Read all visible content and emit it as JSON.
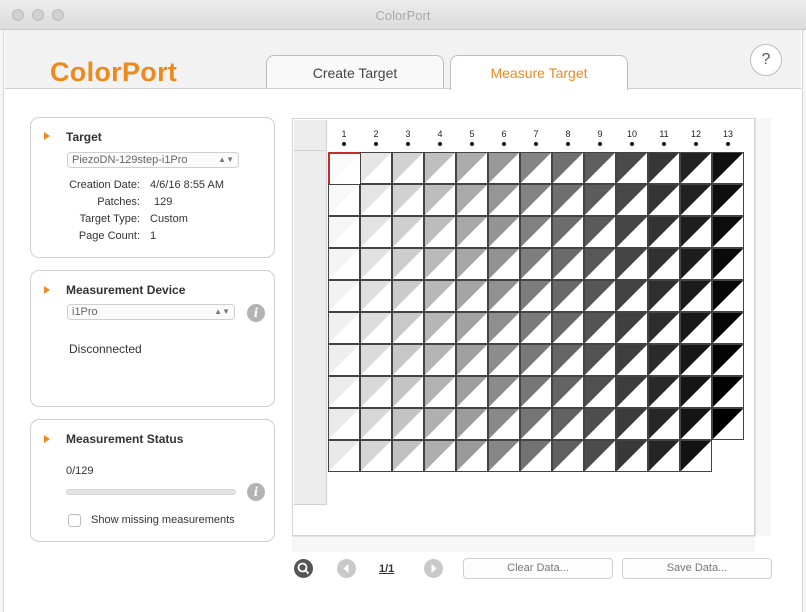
{
  "window": {
    "title": "ColorPort"
  },
  "header": {
    "logo": "ColorPort",
    "help_label": "?",
    "tabs": [
      {
        "label": "Create Target",
        "active": false
      },
      {
        "label": "Measure Target",
        "active": true
      }
    ]
  },
  "target_panel": {
    "title": "Target",
    "selected_target": "PiezoDN-129step-i1Pro",
    "fields": [
      {
        "label": "Creation Date:",
        "value": "4/6/16 8:55 AM"
      },
      {
        "label": "Patches:",
        "value": "129"
      },
      {
        "label": "Target Type:",
        "value": "Custom"
      },
      {
        "label": "Page Count:",
        "value": "1"
      }
    ]
  },
  "device_panel": {
    "title": "Measurement Device",
    "selected_device": "i1Pro",
    "status": "Disconnected"
  },
  "status_panel": {
    "title": "Measurement Status",
    "progress_text": "0/129",
    "progress_fraction": 0,
    "show_missing_label": "Show missing measurements",
    "show_missing_checked": false
  },
  "grid": {
    "columns": [
      "1",
      "2",
      "3",
      "4",
      "5",
      "6",
      "7",
      "8",
      "9",
      "10",
      "11",
      "12",
      "13"
    ],
    "rows": 10,
    "total_patches": 129,
    "selected_patch": 1
  },
  "toolbar": {
    "page_indicator": "1/1",
    "clear_label": "Clear Data...",
    "save_label": "Save Data..."
  },
  "colors": {
    "accent": "#ee8a1d",
    "selection": "#c82a2a"
  },
  "icons": {
    "zoom": "magnifier-icon",
    "prev": "chevron-left-icon",
    "next": "chevron-right-icon",
    "info": "info-icon",
    "disclosure": "triangle-right-icon"
  }
}
